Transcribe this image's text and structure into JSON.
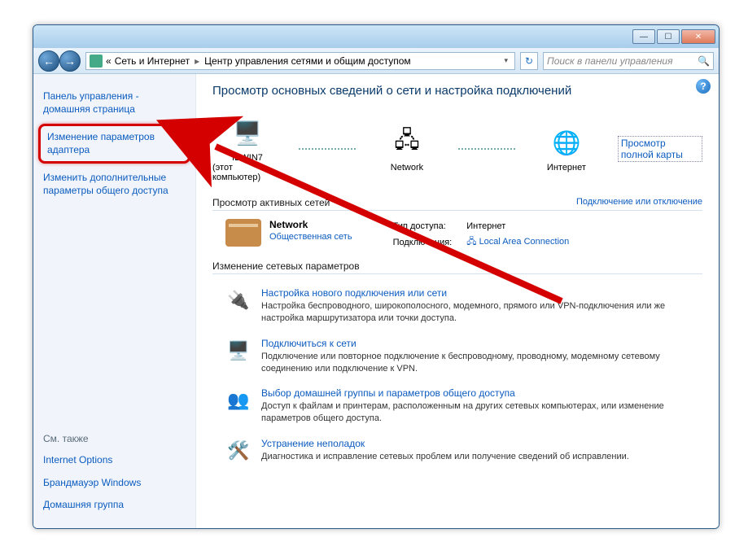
{
  "titlebar": {
    "min": "—",
    "max": "☐",
    "close": "✕"
  },
  "nav": {
    "back": "←",
    "forward": "→",
    "breadcrumb_prefix": "«",
    "breadcrumb_1": "Сеть и Интернет",
    "breadcrumb_2": "Центр управления сетями и общим доступом",
    "refresh": "↻",
    "search_placeholder": "Поиск в панели управления",
    "search_icon": "🔍"
  },
  "sidebar": {
    "home": "Панель управления - домашняя страница",
    "adapter_settings": "Изменение параметров адаптера",
    "advanced_sharing": "Изменить дополнительные параметры общего доступа",
    "see_also": "См. также",
    "internet_options": "Internet Options",
    "firewall": "Брандмауэр Windows",
    "homegroup": "Домашняя группа"
  },
  "help": "?",
  "page_title": "Просмотр основных сведений о сети и настройка подключений",
  "map": {
    "full_map_link": "Просмотр полной карты",
    "node1_name": "IEWIN7",
    "node1_sub": "(этот компьютер)",
    "node2_name": "Network",
    "node3_name": "Интернет"
  },
  "active_networks": {
    "label": "Просмотр активных сетей",
    "right_link": "Подключение или отключение",
    "network_name": "Network",
    "network_type": "Общественная сеть",
    "right_rows": [
      {
        "k": "Тип доступа:",
        "v": "Интернет",
        "link": false
      },
      {
        "k": "Подключения:",
        "v": "Local Area Connection",
        "link": true,
        "icon": "🖧"
      }
    ]
  },
  "change_settings_label": "Изменение сетевых параметров",
  "settings": [
    {
      "icon": "🔌",
      "title": "Настройка нового подключения или сети",
      "desc": "Настройка беспроводного, широкополосного, модемного, прямого или VPN-подключения или же настройка маршрутизатора или точки доступа."
    },
    {
      "icon": "🖥️",
      "title": "Подключиться к сети",
      "desc": "Подключение или повторное подключение к беспроводному, проводному, модемному сетевому соединению или подключение к VPN."
    },
    {
      "icon": "👥",
      "title": "Выбор домашней группы и параметров общего доступа",
      "desc": "Доступ к файлам и принтерам, расположенным на других сетевых компьютерах, или изменение параметров общего доступа."
    },
    {
      "icon": "🛠️",
      "title": "Устранение неполадок",
      "desc": "Диагностика и исправление сетевых проблем или получение сведений об исправлении."
    }
  ]
}
